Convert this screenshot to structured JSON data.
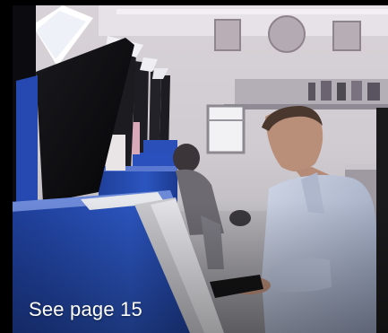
{
  "caption": "See page 15"
}
